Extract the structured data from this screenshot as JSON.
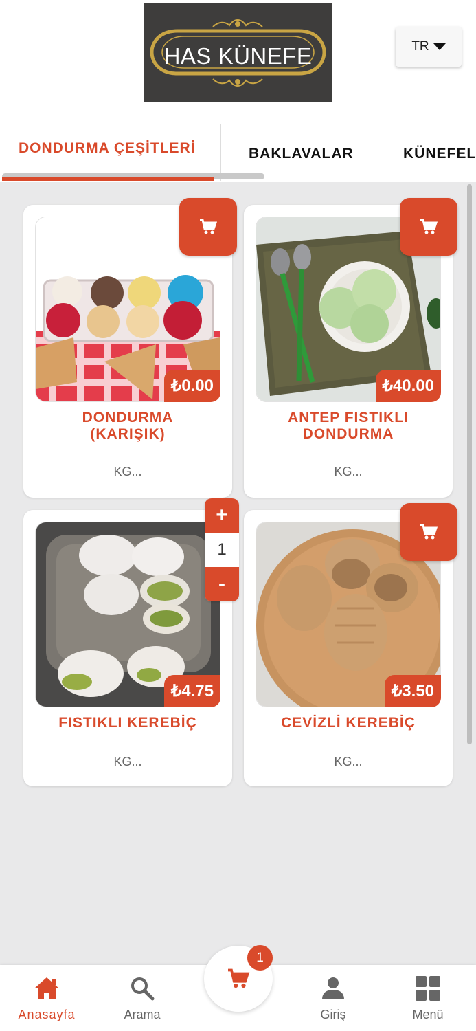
{
  "header": {
    "logo_text": "HAS KÜNEFE",
    "language": "TR"
  },
  "tabs": [
    {
      "label": "DONDURMA ÇEŞİTLERİ",
      "active": true
    },
    {
      "label": "BAKLAVALAR",
      "active": false
    },
    {
      "label": "KÜNEFELER",
      "active": false
    }
  ],
  "products": [
    {
      "name_line1": "DONDURMA",
      "name_line2": "(KARIŞIK)",
      "price": "₺0.00",
      "unit": "KG..."
    },
    {
      "name_line1": "ANTEP FISTIKLI",
      "name_line2": "DONDURMA",
      "price": "₺40.00",
      "unit": "KG..."
    },
    {
      "name_line1": "FISTIKLI KEREBİÇ",
      "price": "₺4.75",
      "unit": "KG...",
      "quantity": "1"
    },
    {
      "name_line1": "CEVİZLİ KEREBİÇ",
      "price": "₺3.50",
      "unit": "KG..."
    }
  ],
  "stepper": {
    "plus": "+",
    "minus": "-"
  },
  "bottom_nav": {
    "home": "Anasayfa",
    "search": "Arama",
    "login": "Giriş",
    "menu": "Menü",
    "cart_badge": "1"
  },
  "colors": {
    "accent": "#d94a2b",
    "background": "#e9e9ea",
    "logo_bg": "#3e3d3c",
    "logo_gold": "#c9a544"
  },
  "icons": [
    "cart-icon",
    "home-icon",
    "search-icon",
    "user-icon",
    "grid-icon",
    "caret-down-icon"
  ]
}
